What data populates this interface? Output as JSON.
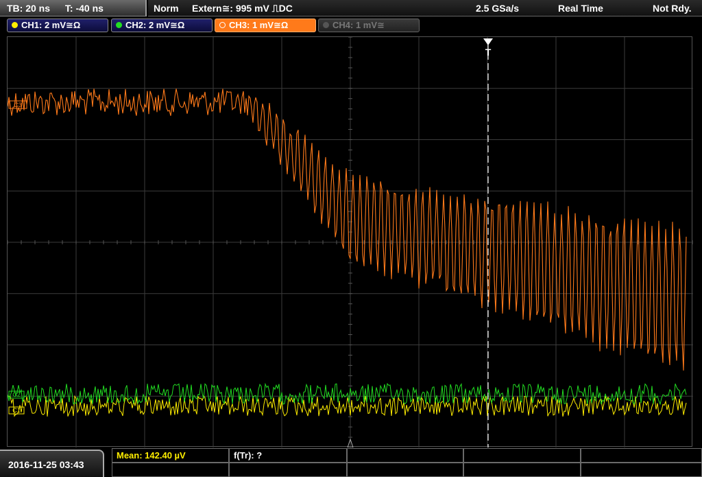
{
  "topbar": {
    "timebase": "TB: 20 ns",
    "trigger_time": "T: -40 ns",
    "trigger_mode": "Norm",
    "trigger_source": "Extern≅: 995 mV ⎍DC",
    "sample_rate": "2.5 GSa/s",
    "acq_mode": "Real Time",
    "state": "Not Rdy."
  },
  "channels": [
    {
      "label": "CH1: 2 mV≅Ω",
      "color": "#ffee00",
      "state": "on"
    },
    {
      "label": "CH2: 2 mV≅Ω",
      "color": "#22dd22",
      "state": "on"
    },
    {
      "label": "CH3: 1 mV≅Ω",
      "color": "#ff7a1a",
      "state": "active"
    },
    {
      "label": "CH4: 1 mV≅",
      "color": "#777777",
      "state": "off"
    }
  ],
  "markers": {
    "ch3_marker": "C3",
    "ch2_marker": "C2",
    "ch1_marker": "C1",
    "trigger_marker": "T"
  },
  "colors": {
    "ch1": "#ffee00",
    "ch2": "#22dd22",
    "ch3": "#ff7a1a",
    "grid": "#3c3c3c"
  },
  "footer": {
    "datetime": "2016-11-25 03:43",
    "measurement_1": "Mean: 142.40 µV",
    "measurement_2": "f(Tr): ?"
  }
}
